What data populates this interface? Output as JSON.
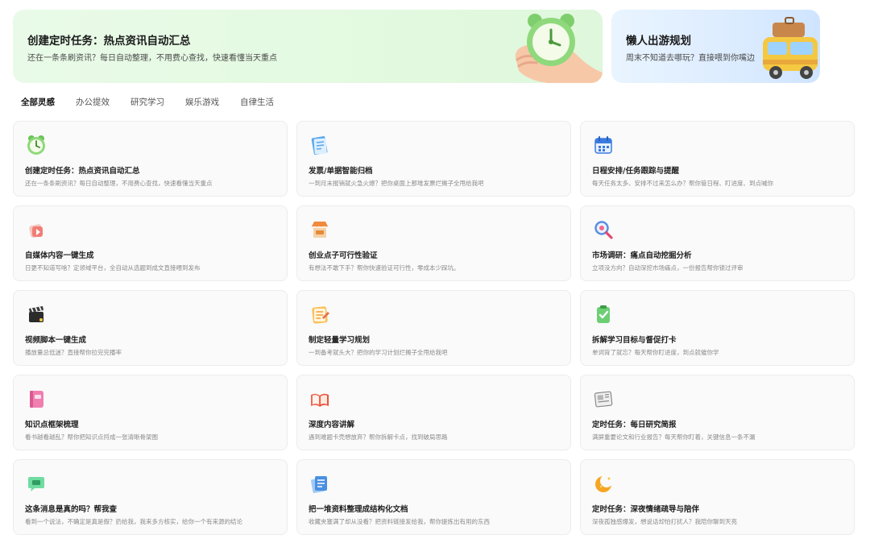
{
  "banners": [
    {
      "title": "创建定时任务：热点资讯自动汇总",
      "subtitle": "还在一条条刷资讯？每日自动整理，不用费心查找，快速看懂当天重点",
      "icon": "alarm-clock-hand-icon"
    },
    {
      "title": "懒人出游规划",
      "subtitle": "周末不知道去哪玩？直接喂到你嘴边",
      "icon": "travel-bus-icon"
    }
  ],
  "tabs": [
    {
      "label": "全部灵感",
      "active": true
    },
    {
      "label": "办公提效",
      "active": false
    },
    {
      "label": "研究学习",
      "active": false
    },
    {
      "label": "娱乐游戏",
      "active": false
    },
    {
      "label": "自律生活",
      "active": false
    }
  ],
  "cards": [
    {
      "title": "创建定时任务：热点资讯自动汇总",
      "desc": "还在一条条刷资讯？每日自动整理，不用费心查找，快速看懂当天重点",
      "icon": "alarm-clock-icon"
    },
    {
      "title": "发票/单据智能归档",
      "desc": "一到月末报销就火急火燎？把你桌面上那堆发票烂摊子全甩给我吧",
      "icon": "invoice-icon"
    },
    {
      "title": "日程安排/任务跟踪与提醒",
      "desc": "每天任务太多、安排不过来怎么办？帮你管日程、盯进度、到点喊你",
      "icon": "calendar-icon"
    },
    {
      "title": "自媒体内容一键生成",
      "desc": "日更不知道写啥？定领域平台，全自动从选题到成文直接喂到发布",
      "icon": "media-content-icon"
    },
    {
      "title": "创业点子可行性验证",
      "desc": "有想法不敢下手？帮你快速验证可行性，零成本少踩坑。",
      "icon": "shop-stall-icon"
    },
    {
      "title": "市场调研：痛点自动挖掘分析",
      "desc": "立项没方向？自动深挖市场痛点，一份报告帮你锁过评审",
      "icon": "magnifier-icon"
    },
    {
      "title": "视频脚本一键生成",
      "desc": "播放量总低迷？直接帮你拉完完播率",
      "icon": "clapperboard-icon"
    },
    {
      "title": "制定轻量学习规划",
      "desc": "一到备考就头大？把你的学习计划烂摊子全甩给我吧",
      "icon": "study-plan-icon"
    },
    {
      "title": "拆解学习目标与督促打卡",
      "desc": "单词背了就忘？每天帮你盯进度，到点就催你学",
      "icon": "checkin-icon"
    },
    {
      "title": "知识点框架梳理",
      "desc": "看书越看越乱？帮你把知识点捋成一张清晰骨架图",
      "icon": "notebook-icon"
    },
    {
      "title": "深度内容讲解",
      "desc": "遇到难题卡壳想放弃？帮你拆解卡点，找到破局思路",
      "icon": "open-book-icon"
    },
    {
      "title": "定时任务：每日研究简报",
      "desc": "满屏重要论文和行业报告？每天帮你盯着，关键信息一条不漏",
      "icon": "newspaper-icon"
    },
    {
      "title": "这条消息是真的吗？帮我查",
      "desc": "看到一个说法，不确定是真是假？扔给我，我来多方核实，给你一个有来源的结论",
      "icon": "chat-bubble-icon"
    },
    {
      "title": "把一堆资料整理成结构化文档",
      "desc": "收藏夹塞满了却从没看？把资料链接发给我，帮你提炼出有用的东西",
      "icon": "documents-stack-icon"
    },
    {
      "title": "定时任务：深夜情绪疏导与陪伴",
      "desc": "深夜孤独感爆发，想说话却怕打扰人？我陪你聊到天亮",
      "icon": "moon-icon"
    }
  ]
}
